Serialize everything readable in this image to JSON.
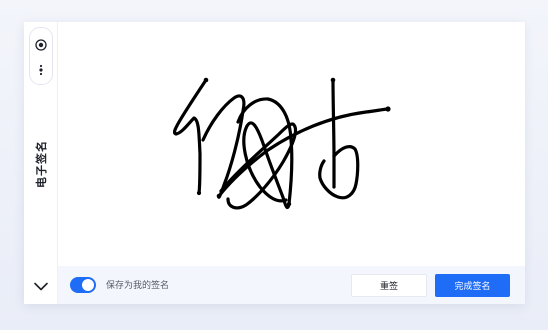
{
  "sidebar": {
    "title": "电子签名",
    "icons": [
      "record-icon",
      "more-vertical-icon",
      "chevron-down-icon"
    ]
  },
  "footer": {
    "save_toggle_label": "保存为我的签名",
    "save_toggle_on": true,
    "reset_label": "重签",
    "done_label": "完成签名"
  },
  "colors": {
    "accent": "#1f6cf6",
    "ink": "#000000",
    "footer_bg": "#f3f6fd"
  }
}
